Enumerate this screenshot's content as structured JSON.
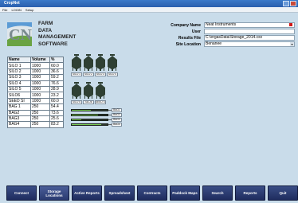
{
  "window": {
    "title": "CropNet"
  },
  "menu": [
    "File",
    "LOGIN",
    "Setup"
  ],
  "app": {
    "name_lines": [
      "FARM",
      "DATA",
      "MANAGEMENT",
      "SOFTWARE"
    ],
    "logo_letters": "CN"
  },
  "form": {
    "company_label": "Company Name",
    "company_value": "Neat Instruments",
    "user_label": "User",
    "user_value": "",
    "results_label": "Results File",
    "results_value": "C:\\ergasData\\Storage_2014.csv",
    "site_label": "Site Location",
    "site_value": "Benanee"
  },
  "table": {
    "headers": [
      "Name",
      "Volume",
      "%"
    ],
    "rows": [
      [
        "SILO 1",
        "1000",
        "60.0"
      ],
      [
        "SILO 2",
        "1000",
        "36.6"
      ],
      [
        "SILO 3",
        "1000",
        "59.2"
      ],
      [
        "SILO 4",
        "1000",
        "76.6"
      ],
      [
        "SILO 5",
        "1000",
        "28.9"
      ],
      [
        "SILO6",
        "1000",
        "23.2"
      ],
      [
        "SEED SI",
        "1000",
        "60.0"
      ],
      [
        "BAG 1",
        "250",
        "54.4"
      ],
      [
        "BAG2",
        "250",
        "73.6"
      ],
      [
        "BAG3",
        "250",
        "25.6"
      ],
      [
        "BAG4",
        "250",
        "83.2"
      ]
    ]
  },
  "silo_row1_labels": [
    "SILO 1",
    "SILO 2",
    "SILO 3",
    "SILO 4"
  ],
  "silo_row2_labels": [
    "SILO 5",
    "SILO6",
    "SEED SI"
  ],
  "bags": [
    {
      "label": "BAG1",
      "fill": 0.544
    },
    {
      "label": "BAG2",
      "fill": 0.736
    },
    {
      "label": "BAG3",
      "fill": 0.256
    },
    {
      "label": "BAG4",
      "fill": 0.832
    }
  ],
  "nav": [
    "Connect",
    "Storage Locations",
    "Active Reports",
    "Spreadsheet",
    "Contracts",
    "Paddock Maps",
    "Search",
    "Reports",
    "Quit"
  ],
  "colors": {
    "background": "#c9dcea",
    "silo": "#2f4033",
    "bag_fill": "#7bcf57",
    "nav_button": "#2a3a70",
    "titlebar": "#2a5fad"
  }
}
